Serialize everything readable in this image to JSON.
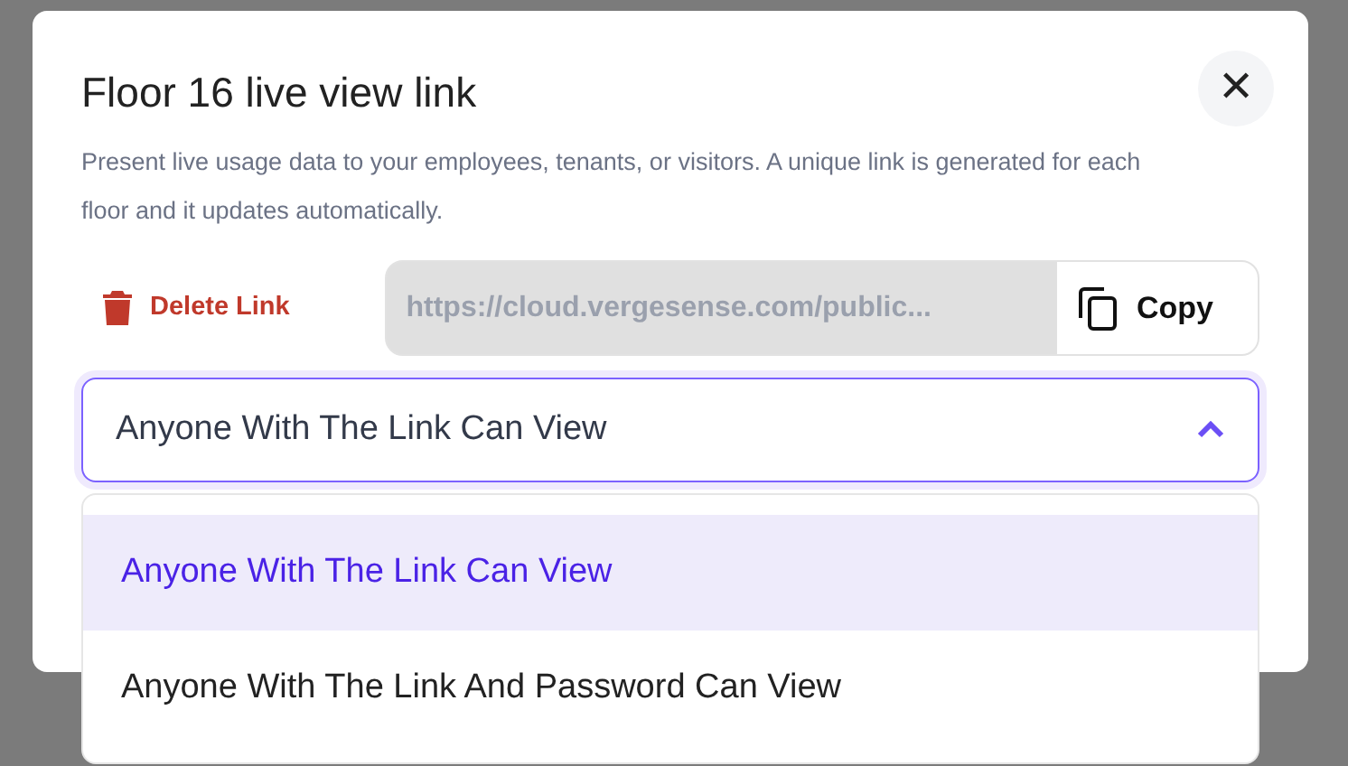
{
  "dialog": {
    "title": "Floor 16 live view link",
    "close_label": "✕",
    "description": "Present live usage data to your employees, tenants, or visitors. A unique link is generated for each floor and it updates automatically."
  },
  "delete_button": {
    "label": "Delete Link"
  },
  "link_field": {
    "value": "https://cloud.vergesense.com/public...",
    "copy_label": "Copy"
  },
  "access_select": {
    "value": "Anyone With The Link Can View",
    "expanded": true,
    "options": [
      {
        "label": "Anyone With The Link Can View",
        "selected": true
      },
      {
        "label": "Anyone With The Link And Password Can View",
        "selected": false
      }
    ]
  }
}
